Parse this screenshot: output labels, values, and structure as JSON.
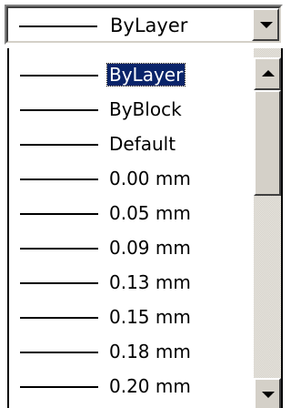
{
  "combo": {
    "selected_label": "ByLayer",
    "button_icon": "dropdown-arrow"
  },
  "list": {
    "items": [
      {
        "label": "ByLayer",
        "selected": true
      },
      {
        "label": "ByBlock",
        "selected": false
      },
      {
        "label": "Default",
        "selected": false
      },
      {
        "label": "0.00 mm",
        "selected": false
      },
      {
        "label": "0.05 mm",
        "selected": false
      },
      {
        "label": "0.09 mm",
        "selected": false
      },
      {
        "label": "0.13 mm",
        "selected": false
      },
      {
        "label": "0.15 mm",
        "selected": false
      },
      {
        "label": "0.18 mm",
        "selected": false
      },
      {
        "label": "0.20 mm",
        "selected": false
      }
    ]
  },
  "scrollbar": {
    "up_icon": "scroll-up-arrow",
    "down_icon": "scroll-down-arrow"
  },
  "colors": {
    "selection_background": "#0a246a",
    "selection_text": "#ffffff",
    "control_face": "#d4d0c8"
  }
}
